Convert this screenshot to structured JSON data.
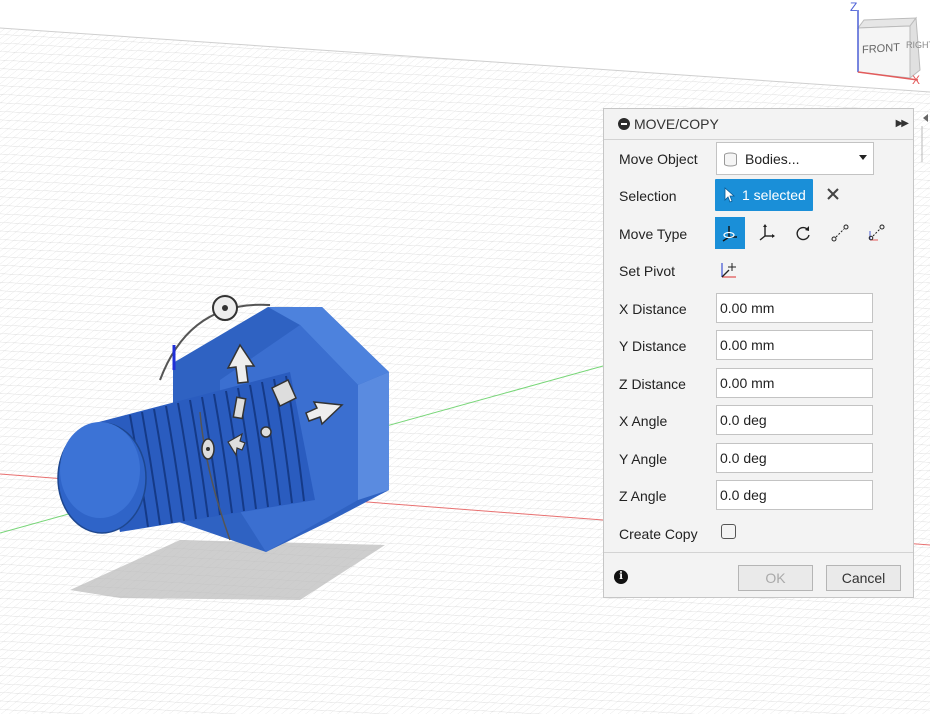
{
  "viewcube": {
    "front_label": "FRONT",
    "right_label": "RIGHT",
    "z_axis": "Z",
    "x_axis": "X"
  },
  "panel": {
    "title": "MOVE/COPY",
    "rows": {
      "move_object": {
        "label": "Move Object",
        "value": "Bodies..."
      },
      "selection": {
        "label": "Selection",
        "value": "1 selected"
      },
      "move_type": {
        "label": "Move Type",
        "options": [
          "free-move-icon",
          "translate-icon",
          "rotate-icon",
          "point-to-point-icon",
          "point-to-position-icon"
        ],
        "active_index": 0
      },
      "set_pivot": {
        "label": "Set Pivot"
      },
      "x_distance": {
        "label": "X Distance",
        "value": "0.00 mm"
      },
      "y_distance": {
        "label": "Y Distance",
        "value": "0.00 mm"
      },
      "z_distance": {
        "label": "Z Distance",
        "value": "0.00 mm"
      },
      "x_angle": {
        "label": "X Angle",
        "value": "0.0 deg"
      },
      "y_angle": {
        "label": "Y Angle",
        "value": "0.0 deg"
      },
      "z_angle": {
        "label": "Z Angle",
        "value": "0.0 deg"
      },
      "create_copy": {
        "label": "Create Copy",
        "checked": false
      }
    },
    "buttons": {
      "ok": "OK",
      "cancel": "Cancel"
    }
  },
  "colors": {
    "accent": "#1a8fd8",
    "body_blue": "#3a6fcf",
    "grid_line": "#d9d9d9",
    "x_axis": "#e35b5b",
    "y_axis": "#5fcf5f",
    "z_axis": "#4b5fd6"
  }
}
